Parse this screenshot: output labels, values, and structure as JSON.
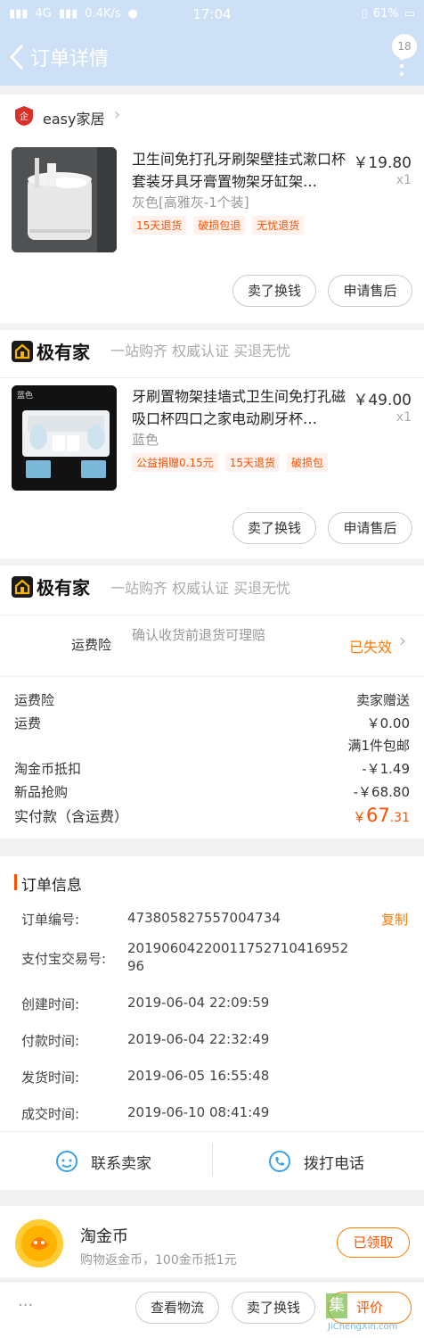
{
  "status": {
    "carrier": "4G",
    "speed": "0.4K/s",
    "time": "17:04",
    "battery": "61%"
  },
  "nav": {
    "title": "订单详情",
    "badge": "18"
  },
  "shop1": {
    "name": "easy家居",
    "item": {
      "title": "卫生间免打孔牙刷架壁挂式漱口杯套装牙具牙膏置物架牙缸架…",
      "price": "￥19.80",
      "qty": "x1",
      "spec": "灰色[高雅灰-1个装]",
      "tags": [
        "15天退货",
        "破损包退",
        "无忧退货"
      ]
    },
    "btn_sell": "卖了换钱",
    "btn_after": "申请售后"
  },
  "shop2": {
    "name": "极有家",
    "slogan": "一站购齐 权威认证 买退无忧",
    "thumb_label": "蓝色",
    "item": {
      "title": "牙刷置物架挂墙式卫生间免打孔磁吸口杯四口之家电动刷牙杯…",
      "price": "￥49.00",
      "qty": "x1",
      "spec": "蓝色",
      "tags": [
        "公益捐赠0.15元",
        "15天退货",
        "破损包"
      ]
    },
    "btn_sell": "卖了换钱",
    "btn_after": "申请售后"
  },
  "shop3": {
    "name": "极有家",
    "slogan": "一站购齐 权威认证 买退无忧"
  },
  "freight": {
    "label": "运费险",
    "desc": "确认收货前退货可理赔",
    "status": "已失效"
  },
  "costs": {
    "rows": [
      {
        "label": "运费险",
        "value": "卖家赠送"
      },
      {
        "label": "运费",
        "value": "￥0.00"
      },
      {
        "label": "",
        "value": "满1件包邮"
      },
      {
        "label": "淘金币抵扣",
        "value": "-￥1.49"
      },
      {
        "label": "新品抢购",
        "value": "-￥68.80"
      }
    ],
    "total_label": "实付款（含运费）",
    "total_symbol": "￥",
    "total_int": "67",
    "total_dec": ".31"
  },
  "order": {
    "heading": "订单信息",
    "order_no_label": "订单编号:",
    "order_no": "473805827557004734",
    "copy": "复制",
    "alipay_label": "支付宝交易号:",
    "alipay_line1": "20190604220011752710416952",
    "alipay_line2": "96",
    "created_label": "创建时间:",
    "created": "2019-06-04 22:09:59",
    "paid_label": "付款时间:",
    "paid": "2019-06-04 22:32:49",
    "shipped_label": "发货时间:",
    "shipped": "2019-06-05 16:55:48",
    "done_label": "成交时间:",
    "done": "2019-06-10 08:41:49"
  },
  "contact": {
    "seller": "联系卖家",
    "phone": "拨打电话"
  },
  "coins": {
    "title": "淘金币",
    "desc": "购物返金币，100金币抵1元",
    "btn": "已领取"
  },
  "bottom": {
    "more": "···",
    "logistics": "查看物流",
    "sell": "卖了换钱",
    "review": "评价"
  },
  "watermark": {
    "text": "JiChengXin.com"
  },
  "colors": {
    "accent": "#ff5000",
    "nav": "#cde0f6",
    "price_red": "#ff5000"
  }
}
